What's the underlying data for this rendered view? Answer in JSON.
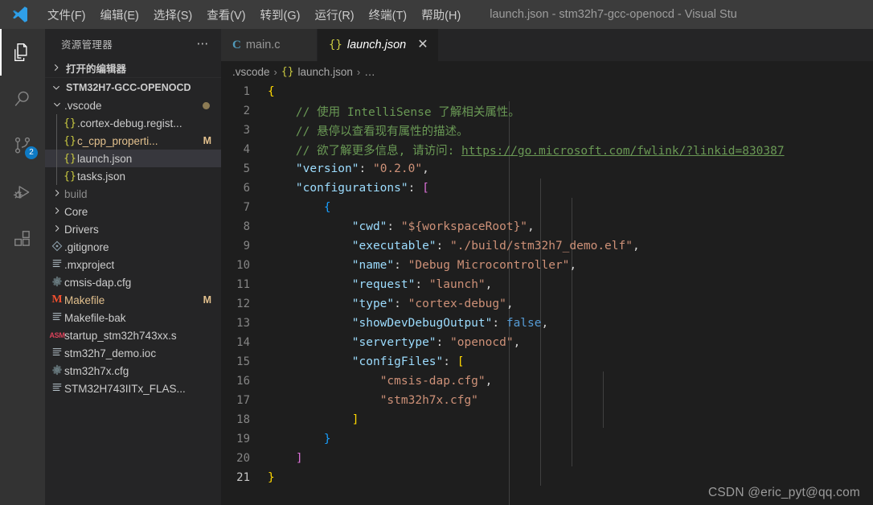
{
  "titlebar": {
    "logo_icon": "vscode-logo-icon",
    "menus": [
      {
        "label": "文件(F)",
        "name": "menu-file"
      },
      {
        "label": "编辑(E)",
        "name": "menu-edit"
      },
      {
        "label": "选择(S)",
        "name": "menu-selection"
      },
      {
        "label": "查看(V)",
        "name": "menu-view"
      },
      {
        "label": "转到(G)",
        "name": "menu-go"
      },
      {
        "label": "运行(R)",
        "name": "menu-run"
      },
      {
        "label": "终端(T)",
        "name": "menu-terminal"
      },
      {
        "label": "帮助(H)",
        "name": "menu-help"
      }
    ],
    "window_title": "launch.json - stm32h7-gcc-openocd - Visual Stu"
  },
  "activitybar": {
    "items": [
      {
        "icon": "files-explorer-icon",
        "active": true,
        "badge": ""
      },
      {
        "icon": "search-icon",
        "active": false,
        "badge": ""
      },
      {
        "icon": "source-control-icon",
        "active": false,
        "badge": "2"
      },
      {
        "icon": "run-and-debug-icon",
        "active": false,
        "badge": ""
      },
      {
        "icon": "extensions-icon",
        "active": false,
        "badge": ""
      }
    ]
  },
  "sidebar": {
    "title": "资源管理器",
    "more_actions_icon": "ellipsis-icon",
    "open_editors_label": "打开的编辑器",
    "project_label": "STM32H7-GCC-OPENOCD",
    "tree": [
      {
        "label": ".vscode",
        "indent": 1,
        "kind": "folder",
        "icon": "chevron-down-icon",
        "state": "expanded",
        "mark": "",
        "dot": true
      },
      {
        "label": ".cortex-debug.regist...",
        "indent": 2,
        "kind": "json",
        "icon": "json-braces-icon",
        "state": "",
        "mark": "",
        "dot": false
      },
      {
        "label": "c_cpp_properti...",
        "indent": 2,
        "kind": "json",
        "icon": "json-braces-icon",
        "state": "modified",
        "mark": "M",
        "dot": false
      },
      {
        "label": "launch.json",
        "indent": 2,
        "kind": "json",
        "icon": "json-braces-icon",
        "state": "selected",
        "mark": "",
        "dot": false
      },
      {
        "label": "tasks.json",
        "indent": 2,
        "kind": "json",
        "icon": "json-braces-icon",
        "state": "",
        "mark": "",
        "dot": false
      },
      {
        "label": "build",
        "indent": 1,
        "kind": "folder",
        "icon": "chevron-right-icon",
        "state": "ignored",
        "mark": "",
        "dot": false
      },
      {
        "label": "Core",
        "indent": 1,
        "kind": "folder",
        "icon": "chevron-right-icon",
        "state": "",
        "mark": "",
        "dot": false
      },
      {
        "label": "Drivers",
        "indent": 1,
        "kind": "folder",
        "icon": "chevron-right-icon",
        "state": "",
        "mark": "",
        "dot": false
      },
      {
        "label": ".gitignore",
        "indent": 1,
        "kind": "git",
        "icon": "git-file-icon",
        "state": "",
        "mark": "",
        "dot": false
      },
      {
        "label": ".mxproject",
        "indent": 1,
        "kind": "text",
        "icon": "text-file-icon",
        "state": "",
        "mark": "",
        "dot": false
      },
      {
        "label": "cmsis-dap.cfg",
        "indent": 1,
        "kind": "config",
        "icon": "gear-icon",
        "state": "",
        "mark": "",
        "dot": false
      },
      {
        "label": "Makefile",
        "indent": 1,
        "kind": "make",
        "icon": "makefile-m-icon",
        "state": "modified",
        "mark": "M",
        "dot": false
      },
      {
        "label": "Makefile-bak",
        "indent": 1,
        "kind": "text",
        "icon": "text-file-icon",
        "state": "",
        "mark": "",
        "dot": false
      },
      {
        "label": "startup_stm32h743xx.s",
        "indent": 1,
        "kind": "asm",
        "icon": "asm-file-icon",
        "state": "",
        "mark": "",
        "dot": false
      },
      {
        "label": "stm32h7_demo.ioc",
        "indent": 1,
        "kind": "text",
        "icon": "text-file-icon",
        "state": "",
        "mark": "",
        "dot": false
      },
      {
        "label": "stm32h7x.cfg",
        "indent": 1,
        "kind": "config",
        "icon": "gear-icon",
        "state": "",
        "mark": "",
        "dot": false
      },
      {
        "label": "STM32H743IITx_FLAS...",
        "indent": 1,
        "kind": "text",
        "icon": "text-file-icon",
        "state": "",
        "mark": "",
        "dot": false
      }
    ]
  },
  "editor": {
    "tabs": [
      {
        "label": "main.c",
        "icon": "c-file-icon",
        "active": false,
        "closable": false
      },
      {
        "label": "launch.json",
        "icon": "json-braces-icon",
        "active": true,
        "closable": true,
        "close_icon": "close-icon"
      }
    ],
    "breadcrumb": [
      {
        "label": ".vscode",
        "icon": ""
      },
      {
        "label": "launch.json",
        "icon": "json-braces-icon"
      },
      {
        "label": "…",
        "icon": ""
      }
    ],
    "breadcrumb_separator": "›",
    "active_line": 21,
    "lines": [
      {
        "n": 1,
        "tokens": [
          {
            "t": "{",
            "c": "b-yellow"
          }
        ],
        "indent": 0
      },
      {
        "n": 2,
        "tokens": [
          {
            "t": "    // 使用 IntelliSense 了解相关属性。",
            "c": "t-cmt"
          }
        ],
        "indent": 1
      },
      {
        "n": 3,
        "tokens": [
          {
            "t": "    // 悬停以查看现有属性的描述。",
            "c": "t-cmt"
          }
        ],
        "indent": 1
      },
      {
        "n": 4,
        "tokens": [
          {
            "t": "    // 欲了解更多信息, 请访问: ",
            "c": "t-cmt"
          },
          {
            "t": "https://go.microsoft.com/fwlink/?linkid=830387",
            "c": "t-link"
          }
        ],
        "indent": 1
      },
      {
        "n": 5,
        "tokens": [
          {
            "t": "    ",
            "c": ""
          },
          {
            "t": "\"version\"",
            "c": "t-key"
          },
          {
            "t": ": ",
            "c": "t-punct"
          },
          {
            "t": "\"0.2.0\"",
            "c": "t-str"
          },
          {
            "t": ",",
            "c": "t-punct"
          }
        ],
        "indent": 1
      },
      {
        "n": 6,
        "tokens": [
          {
            "t": "    ",
            "c": ""
          },
          {
            "t": "\"configurations\"",
            "c": "t-key"
          },
          {
            "t": ": ",
            "c": "t-punct"
          },
          {
            "t": "[",
            "c": "b-pink"
          }
        ],
        "indent": 1
      },
      {
        "n": 7,
        "tokens": [
          {
            "t": "        ",
            "c": ""
          },
          {
            "t": "{",
            "c": "b-blue"
          }
        ],
        "indent": 2
      },
      {
        "n": 8,
        "tokens": [
          {
            "t": "            ",
            "c": ""
          },
          {
            "t": "\"cwd\"",
            "c": "t-key"
          },
          {
            "t": ": ",
            "c": "t-punct"
          },
          {
            "t": "\"${workspaceRoot}\"",
            "c": "t-str"
          },
          {
            "t": ",",
            "c": "t-punct"
          }
        ],
        "indent": 3
      },
      {
        "n": 9,
        "tokens": [
          {
            "t": "            ",
            "c": ""
          },
          {
            "t": "\"executable\"",
            "c": "t-key"
          },
          {
            "t": ": ",
            "c": "t-punct"
          },
          {
            "t": "\"./build/stm32h7_demo.elf\"",
            "c": "t-str"
          },
          {
            "t": ",",
            "c": "t-punct"
          }
        ],
        "indent": 3
      },
      {
        "n": 10,
        "tokens": [
          {
            "t": "            ",
            "c": ""
          },
          {
            "t": "\"name\"",
            "c": "t-key"
          },
          {
            "t": ": ",
            "c": "t-punct"
          },
          {
            "t": "\"Debug Microcontroller\"",
            "c": "t-str"
          },
          {
            "t": ",",
            "c": "t-punct"
          }
        ],
        "indent": 3
      },
      {
        "n": 11,
        "tokens": [
          {
            "t": "            ",
            "c": ""
          },
          {
            "t": "\"request\"",
            "c": "t-key"
          },
          {
            "t": ": ",
            "c": "t-punct"
          },
          {
            "t": "\"launch\"",
            "c": "t-str"
          },
          {
            "t": ",",
            "c": "t-punct"
          }
        ],
        "indent": 3
      },
      {
        "n": 12,
        "tokens": [
          {
            "t": "            ",
            "c": ""
          },
          {
            "t": "\"type\"",
            "c": "t-key"
          },
          {
            "t": ": ",
            "c": "t-punct"
          },
          {
            "t": "\"cortex-debug\"",
            "c": "t-str"
          },
          {
            "t": ",",
            "c": "t-punct"
          }
        ],
        "indent": 3
      },
      {
        "n": 13,
        "tokens": [
          {
            "t": "            ",
            "c": ""
          },
          {
            "t": "\"showDevDebugOutput\"",
            "c": "t-key"
          },
          {
            "t": ": ",
            "c": "t-punct"
          },
          {
            "t": "false",
            "c": "t-bool"
          },
          {
            "t": ",",
            "c": "t-punct"
          }
        ],
        "indent": 3
      },
      {
        "n": 14,
        "tokens": [
          {
            "t": "            ",
            "c": ""
          },
          {
            "t": "\"servertype\"",
            "c": "t-key"
          },
          {
            "t": ": ",
            "c": "t-punct"
          },
          {
            "t": "\"openocd\"",
            "c": "t-str"
          },
          {
            "t": ",",
            "c": "t-punct"
          }
        ],
        "indent": 3
      },
      {
        "n": 15,
        "tokens": [
          {
            "t": "            ",
            "c": ""
          },
          {
            "t": "\"configFiles\"",
            "c": "t-key"
          },
          {
            "t": ": ",
            "c": "t-punct"
          },
          {
            "t": "[",
            "c": "b-yellow"
          }
        ],
        "indent": 3
      },
      {
        "n": 16,
        "tokens": [
          {
            "t": "                ",
            "c": ""
          },
          {
            "t": "\"cmsis-dap.cfg\"",
            "c": "t-str"
          },
          {
            "t": ",",
            "c": "t-punct"
          }
        ],
        "indent": 4
      },
      {
        "n": 17,
        "tokens": [
          {
            "t": "                ",
            "c": ""
          },
          {
            "t": "\"stm32h7x.cfg\"",
            "c": "t-str"
          }
        ],
        "indent": 4
      },
      {
        "n": 18,
        "tokens": [
          {
            "t": "            ",
            "c": ""
          },
          {
            "t": "]",
            "c": "b-yellow"
          }
        ],
        "indent": 3
      },
      {
        "n": 19,
        "tokens": [
          {
            "t": "        ",
            "c": ""
          },
          {
            "t": "}",
            "c": "b-blue"
          }
        ],
        "indent": 2
      },
      {
        "n": 20,
        "tokens": [
          {
            "t": "    ",
            "c": ""
          },
          {
            "t": "]",
            "c": "b-pink"
          }
        ],
        "indent": 1
      },
      {
        "n": 21,
        "tokens": [
          {
            "t": "}",
            "c": "b-yellow"
          }
        ],
        "indent": 0
      }
    ]
  },
  "watermark": "CSDN @eric_pyt@qq.com",
  "colors": {
    "titlebar_bg": "#3c3c3c",
    "activitybar_bg": "#333333",
    "sidebar_bg": "#252526",
    "editor_bg": "#1e1e1e",
    "badge_bg": "#0e7ac4",
    "selection_bg": "#37373d",
    "modified_fg": "#e2c08d",
    "key_fg": "#9cdcfe",
    "string_fg": "#ce9178",
    "comment_fg": "#6a9955",
    "boolean_fg": "#569cd6"
  }
}
